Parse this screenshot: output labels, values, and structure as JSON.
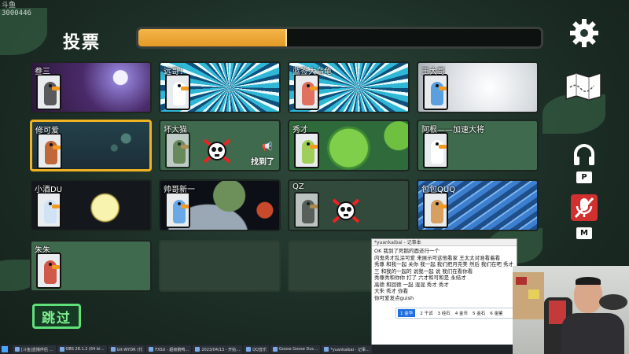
{
  "watermark": {
    "line1": "斗鱼",
    "line2": "3000446"
  },
  "header": {
    "title": "投票",
    "progress": 0.37
  },
  "colors": {
    "accent": "#f1b322",
    "progress": "#e9a132",
    "skip": "#5fe07a"
  },
  "side_icons": [
    {
      "name": "settings-gear-icon"
    },
    {
      "name": "map-icon"
    },
    {
      "name": "headphones-icon",
      "key": "P"
    },
    {
      "name": "mic-muted-icon",
      "key": "M"
    }
  ],
  "players": [
    {
      "name": "叁三",
      "bg": "night-clock",
      "color": "#5a5a5a",
      "selected": false,
      "dead": false,
      "found": false
    },
    {
      "name": "远哥！",
      "bg": "speed",
      "color": "#ffffff",
      "selected": false,
      "dead": false,
      "found": false
    },
    {
      "name": "蓝签大乌龟",
      "bg": "speed",
      "color": "#e07060",
      "selected": false,
      "dead": false,
      "found": false
    },
    {
      "name": "王大哥",
      "bg": "silver",
      "color": "#5aa0e0",
      "selected": false,
      "dead": false,
      "found": false
    },
    {
      "name": "修可爱",
      "bg": "bubbles",
      "color": "#c0683a",
      "selected": true,
      "dead": false,
      "found": false
    },
    {
      "name": "坏大猫",
      "bg": "plain",
      "color": "#6a9a48",
      "selected": false,
      "dead": true,
      "found": true,
      "found_label": "找到了"
    },
    {
      "name": "秀才",
      "bg": "lilypad",
      "color": "#9fcf5a",
      "selected": false,
      "dead": false,
      "found": false
    },
    {
      "name": "阿根——加速大将",
      "bg": "plain",
      "color": "#ffffff",
      "selected": false,
      "dead": false,
      "found": false
    },
    {
      "name": "小酒DU",
      "bg": "moon",
      "color": "#cfe3f5",
      "selected": false,
      "dead": false,
      "found": false
    },
    {
      "name": "帅哥新一",
      "bg": "space",
      "color": "#6aa8e8",
      "selected": false,
      "dead": false,
      "found": false
    },
    {
      "name": "QZ",
      "bg": "plain-dark",
      "color": "#666666",
      "selected": false,
      "dead": true,
      "found": false
    },
    {
      "name": "包包QUQ",
      "bg": "waves",
      "color": "#d8a060",
      "selected": false,
      "dead": false,
      "found": false
    },
    {
      "name": "朱朱",
      "bg": "plain",
      "color": "#d05a4a",
      "selected": false,
      "dead": false,
      "found": false
    },
    {
      "name": "",
      "bg": "empty",
      "color": "",
      "empty": true
    },
    {
      "name": "",
      "bg": "empty",
      "color": "",
      "empty": true
    }
  ],
  "skip_label": "跳过",
  "chat": {
    "title": "*yuankaibai - 记事本",
    "lines": [
      "OK 我到了死鹅的面还行一个",
      "内鬼秀才乱涂可爱 来展示可这他看家 王太太对准看着看",
      "秀尊 和我一起 关你 我一起 我们把月完美 然后 我们在吧 秀才",
      "三 和我的一起的 说我一起 说 我们在看你看",
      "秀尊秀和你你 打了 六才和可和是 永结才",
      "高德 和回德 一起 混混 秀才 秀才",
      "大朱 秀才 你看",
      "你可爱发点guish"
    ],
    "ime": [
      "1 金华",
      "2 干试",
      "3 经石",
      "4 金币",
      "5 金石",
      "6 金鉴"
    ]
  },
  "taskbar": [
    "[斗鱼]直播伴侣 …",
    "OBS 28.1.2 (64 bi…",
    "Git-WYDR (代",
    "FXSU - 超级鹅鸭…",
    "2023/04/13 - 开始…",
    "QQ音乐",
    "Goose Goose Duc…",
    "*yuankaibai - 记事…"
  ]
}
